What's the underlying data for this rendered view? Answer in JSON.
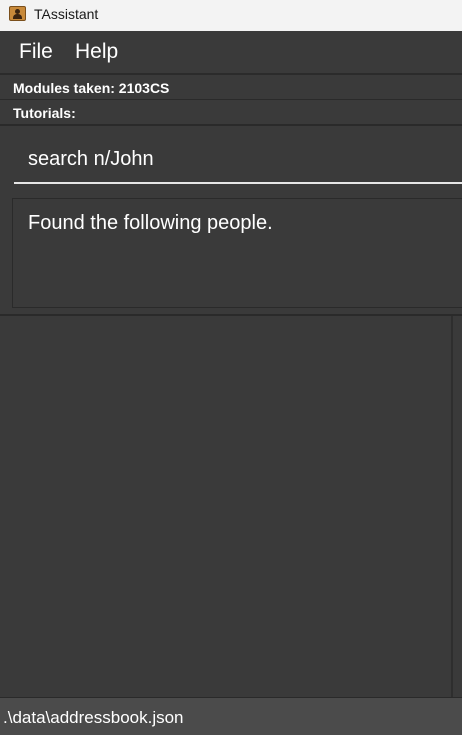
{
  "window": {
    "title": "TAssistant",
    "icon": "address-book-icon"
  },
  "menu": {
    "items": [
      "File",
      "Help"
    ]
  },
  "info": {
    "modules_label": "Modules taken: 2103CS",
    "tutorials_label": "Tutorials:"
  },
  "command": {
    "value": "search n/John"
  },
  "result": {
    "message": "Found the following people."
  },
  "status": {
    "save_location": ".\\data\\addressbook.json"
  },
  "colors": {
    "background": "#3a3a3a",
    "titlebar": "#f3f3f3",
    "statusbar": "#4b4b4b",
    "text": "#ffffff"
  }
}
